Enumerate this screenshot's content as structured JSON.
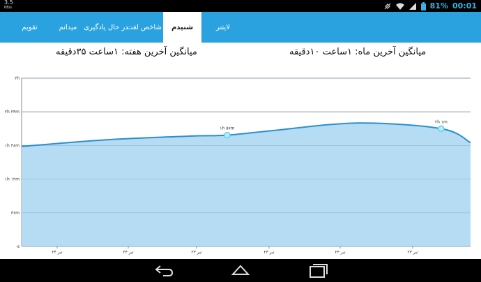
{
  "status_bar": {
    "left_text": "3.5",
    "left_subtext": "KB/s",
    "battery": "81%",
    "time": "00:01",
    "icons": [
      "alarm-off-icon",
      "wifi-icon",
      "signal-icon",
      "battery-icon"
    ]
  },
  "tabs": [
    {
      "label": "لایتنر",
      "active": false
    },
    {
      "label": "شنیدم",
      "active": true
    },
    {
      "label": "شاخص لغت",
      "active": false
    },
    {
      "label": "در حال یادگیری",
      "active": false
    },
    {
      "label": "میدانم",
      "active": false
    },
    {
      "label": "تقویم",
      "active": false
    }
  ],
  "averages": {
    "month": "میانگین آخرین ماه: ۱ساعت ۱۰دقیقه",
    "week": "میانگین آخرین هفته: ۱ساعت ۳۵دقیقه"
  },
  "chart_data": {
    "type": "area",
    "y_ticks": [
      "۳h",
      "۲h ۲۴m",
      "۱h ۴۸m",
      "۱h ۱۲m",
      "۳۶m",
      "۰s"
    ],
    "y_tick_values": [
      180,
      144,
      108,
      72,
      36,
      0
    ],
    "ylim": [
      0,
      180
    ],
    "x_ticks": [
      "۲۴ تیر",
      "۲۴ تیر",
      "۲۳ تیر",
      "۲۳ تیر",
      "۲۳ تیر",
      "۲۳ تیر"
    ],
    "points": [
      {
        "x": 0,
        "y": 107
      },
      {
        "x": 1,
        "y": 114
      },
      {
        "x": 2,
        "y": 118
      },
      {
        "x": 2.45,
        "y": 119
      },
      {
        "x": 3,
        "y": 124
      },
      {
        "x": 4,
        "y": 132
      },
      {
        "x": 5,
        "y": 126
      },
      {
        "x": 5.35,
        "y": 111
      }
    ],
    "labeled_points": [
      {
        "x": 2.45,
        "y": 119,
        "label": "۱h ۵۷m"
      },
      {
        "x": 5,
        "y": 126,
        "label": "۲h ۱m"
      }
    ],
    "grid": true,
    "line_color": "#2a8fd0",
    "fill_color": "#b5dcf3"
  },
  "colors": {
    "tabbar": "#2aa2df",
    "accent": "#33b5e5"
  },
  "nav": {
    "icons": [
      "back-icon",
      "home-icon",
      "recent-apps-icon"
    ]
  }
}
